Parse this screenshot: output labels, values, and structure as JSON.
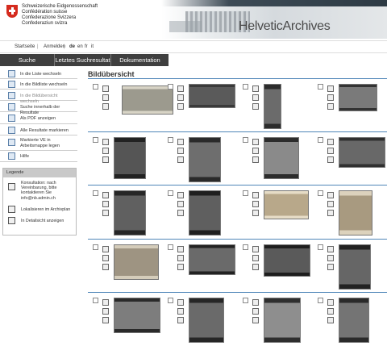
{
  "header": {
    "confederation": [
      "Schweizerische Eidgenossenschaft",
      "Confédération suisse",
      "Confederazione Svizzera",
      "Confederaziun svizra"
    ],
    "app_title": "HelveticArchives"
  },
  "metanav": {
    "home": "Startseite",
    "separator": "|",
    "login": "Anmelden",
    "lang_de": "de",
    "lang_en": "en",
    "lang_fr": "fr",
    "lang_it": "it"
  },
  "tabs": [
    "Suche",
    "Letztes Suchresultat",
    "Dokumentation"
  ],
  "sidebar": {
    "items": [
      {
        "label": "In die Liste wechseln",
        "dim": false,
        "icon": "list-view-icon"
      },
      {
        "label": "In die Bildliste wechseln",
        "dim": false,
        "icon": "image-list-icon"
      },
      {
        "label": "In die Bildübersicht wechseln",
        "dim": true,
        "icon": "image-overview-icon"
      },
      {
        "label": "Suche innerhalb der Resultate",
        "dim": false,
        "icon": "search-results-icon"
      },
      {
        "label": "Als PDF anzeigen",
        "dim": false,
        "icon": "pdf-icon"
      },
      {
        "label": "Alle Resultate markieren",
        "dim": false,
        "icon": "mark-all-icon"
      },
      {
        "label": "Markierte VE in Arbeitsmappe legen",
        "dim": false,
        "icon": "folder-icon"
      },
      {
        "label": "Hilfe",
        "dim": false,
        "icon": "help-icon"
      }
    ]
  },
  "legend": {
    "title": "Legende",
    "items": [
      {
        "label": "Konsultation: nach Vereinbarung, bitte kontaktieren Sie info@nb.admin.ch",
        "icon": "consultation-icon"
      },
      {
        "label": "Lokalisieren im Archivplan",
        "icon": "locate-icon"
      },
      {
        "label": "In Detailsicht anzeigen",
        "icon": "detail-view-icon"
      }
    ]
  },
  "main": {
    "title": "Bildübersicht",
    "rows": [
      [
        {
          "thumb_color": "#9c9a8e",
          "frame": "#d8d4c6"
        },
        {
          "thumb_color": "#5a5a5a",
          "frame": "#3a3a3a"
        },
        {
          "thumb_color": "#6b6b6b",
          "frame": "#2c2c2c"
        },
        {
          "thumb_color": "#7a7a7a",
          "frame": "#333333"
        }
      ],
      [
        {
          "thumb_color": "#555555",
          "frame": "#222222"
        },
        {
          "thumb_color": "#6e6e6e",
          "frame": "#2a2a2a"
        },
        {
          "thumb_color": "#8a8a8a",
          "frame": "#2c2c2c"
        },
        {
          "thumb_color": "#686868",
          "frame": "#303030"
        }
      ],
      [
        {
          "thumb_color": "#606060",
          "frame": "#262626"
        },
        {
          "thumb_color": "#5f5f5f",
          "frame": "#1f1f1f"
        },
        {
          "thumb_color": "#b8a88a",
          "frame": "#e6dcc6"
        },
        {
          "thumb_color": "#a89a80",
          "frame": "#dcd2bd"
        }
      ],
      [
        {
          "thumb_color": "#9e9482",
          "frame": "#d4ccba"
        },
        {
          "thumb_color": "#6a6a6a",
          "frame": "#222222"
        },
        {
          "thumb_color": "#5a5a5a",
          "frame": "#1e1e1e"
        },
        {
          "thumb_color": "#666666",
          "frame": "#222222"
        }
      ],
      [
        {
          "thumb_color": "#7d7d7d",
          "frame": "#2a2a2a"
        },
        {
          "thumb_color": "#6a6a6a",
          "frame": "#262626"
        },
        {
          "thumb_color": "#8e8e8e",
          "frame": "#2e2e2e"
        },
        {
          "thumb_color": "#747474",
          "frame": "#2a2a2a"
        }
      ]
    ]
  },
  "colors": {
    "tabbar": "#3f3f3f",
    "row_separator": "#4f86b8",
    "crest": "#d52b1e"
  }
}
